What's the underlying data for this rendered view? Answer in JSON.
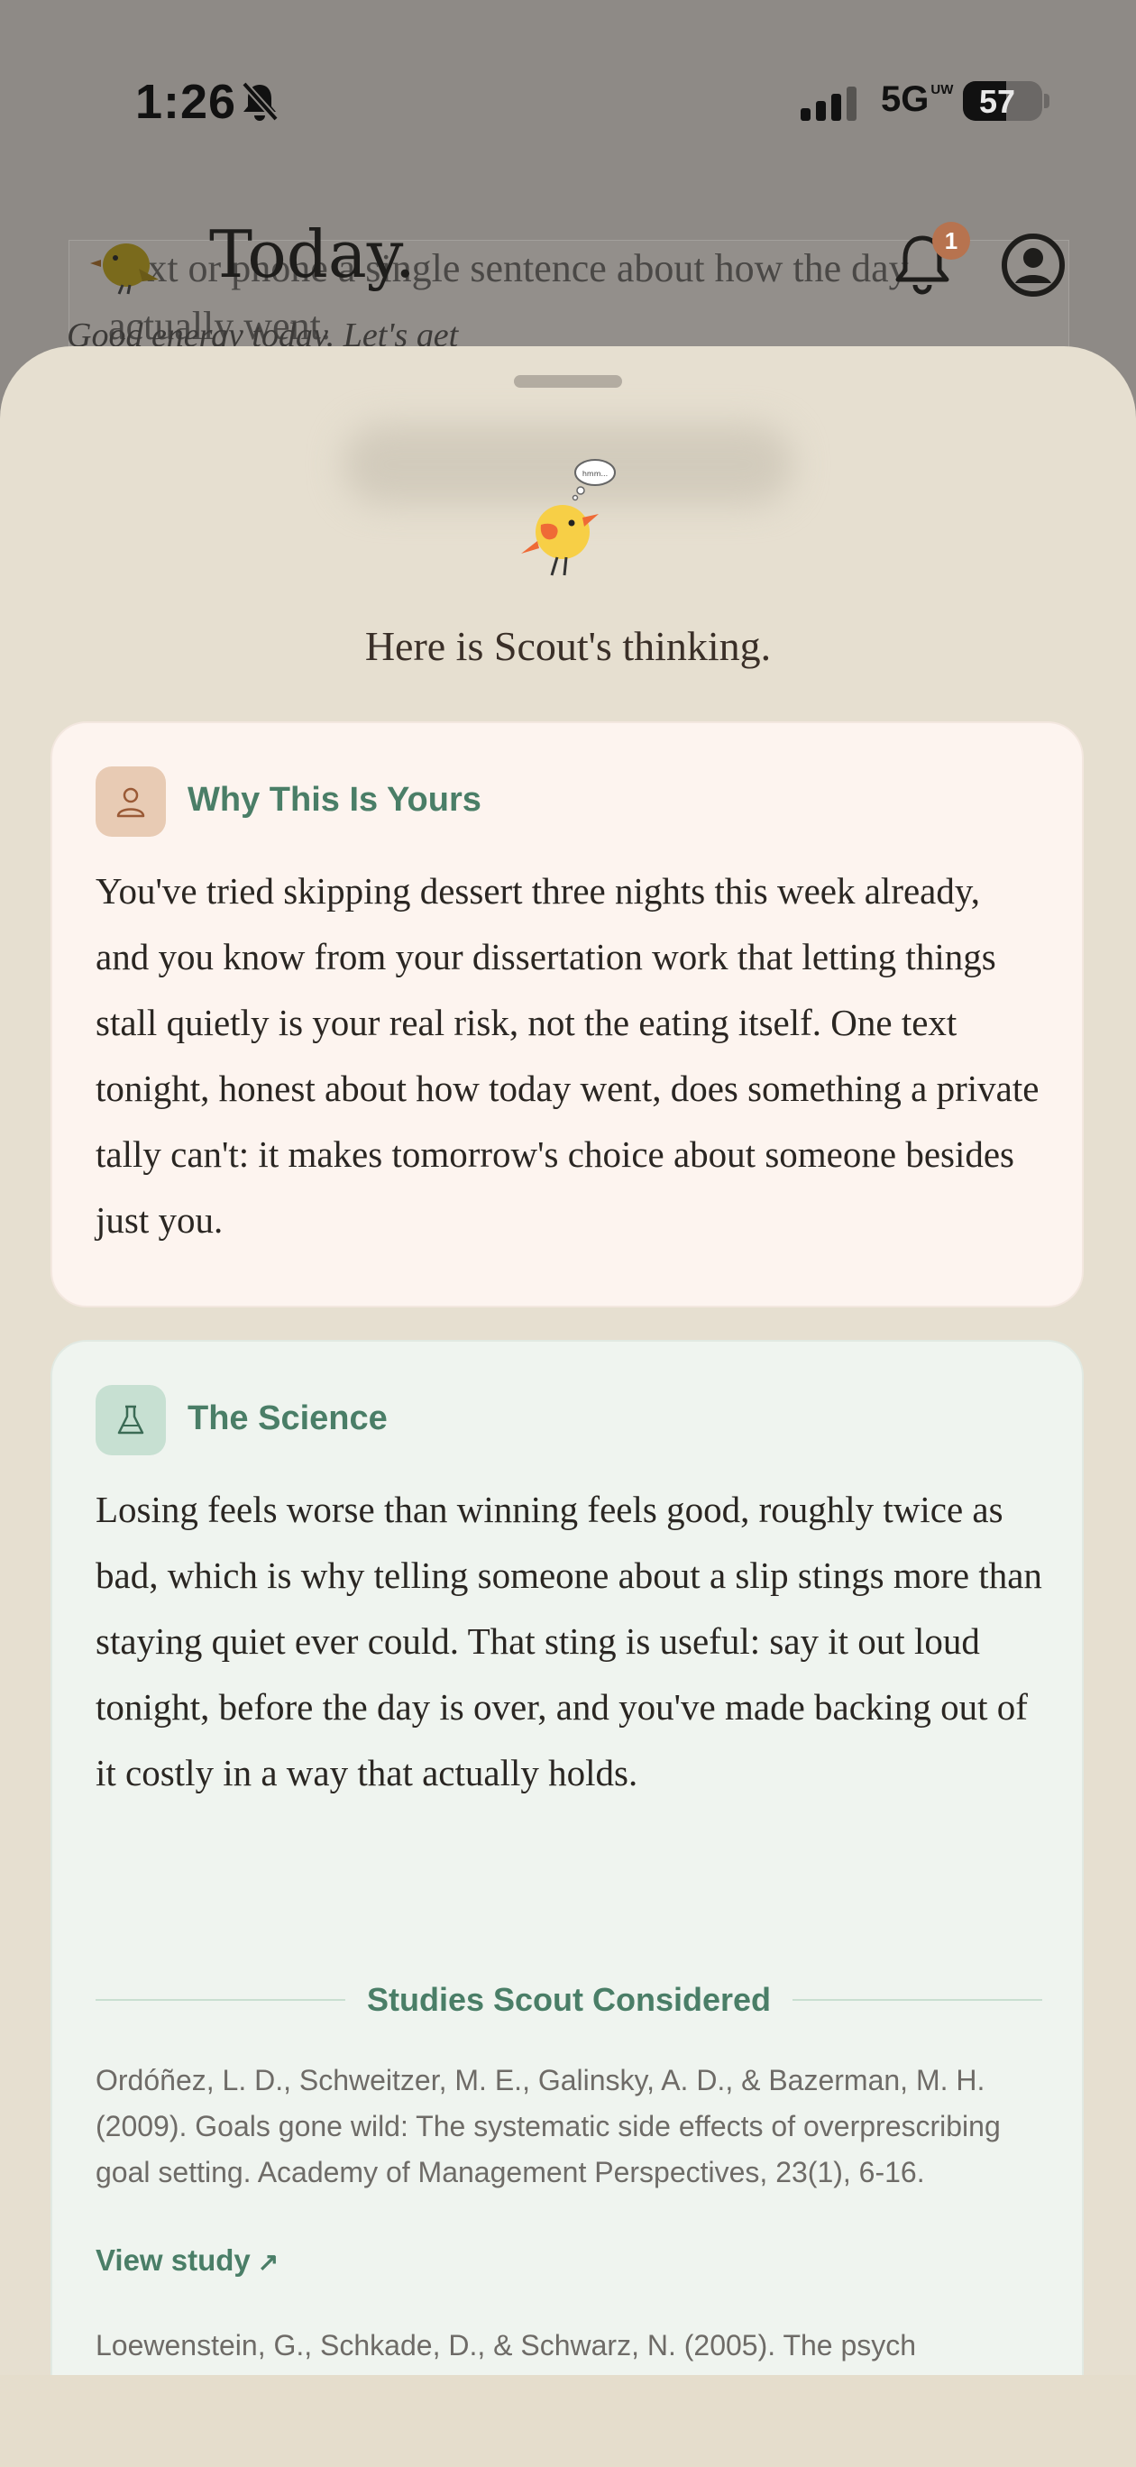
{
  "status_bar": {
    "time": "1:26",
    "network": "5G",
    "network_superscript": "UW",
    "battery": "57"
  },
  "background": {
    "title": "Today.",
    "card_text": "Text or phone a single sentence about how the day actually went.",
    "hint": "Good energy today. Let's get",
    "notification_count": "1"
  },
  "sheet": {
    "bird_bubble": "hmm...",
    "heading": "Here is Scout's thinking.",
    "why_card": {
      "title": "Why This Is Yours",
      "body": "You've tried skipping dessert three nights this week already, and you know from your dissertation work that letting things stall quietly is your real risk, not the eating itself. One text tonight, honest about how today went, does something a private tally can't: it makes tomorrow's choice about someone besides just you."
    },
    "science_card": {
      "title": "The Science",
      "body": "Losing feels worse than winning feels good, roughly twice as bad, which is why telling someone about a slip stings more than staying quiet ever could. That sting is useful: say it out loud tonight, before the day is over, and you've made backing out of it costly in a way that actually holds.",
      "studies_heading": "Studies Scout Considered",
      "citations": [
        "Ordóñez, L. D., Schweitzer, M. E., Galinsky, A. D., & Bazerman, M. H. (2009). Goals gone wild: The systematic side effects of overprescribing goal setting. Academy of Management Perspectives, 23(1), 6-16.",
        "Loewenstein, G., Schkade, D., & Schwarz, N. (2005). The psych"
      ],
      "view_study_label": "View study"
    }
  },
  "colors": {
    "accent_green": "#4a7e67",
    "sheet_bg": "#e6dfd0",
    "why_card_bg": "#fdf4ef",
    "science_card_bg": "#eff4ef",
    "notification_badge": "#b7734f"
  },
  "icons": [
    "bell-slash-icon",
    "signal-icon",
    "bell-icon",
    "account-circle-icon",
    "bird-logo-icon",
    "person-icon",
    "flask-icon",
    "arrow-up-right-icon"
  ]
}
